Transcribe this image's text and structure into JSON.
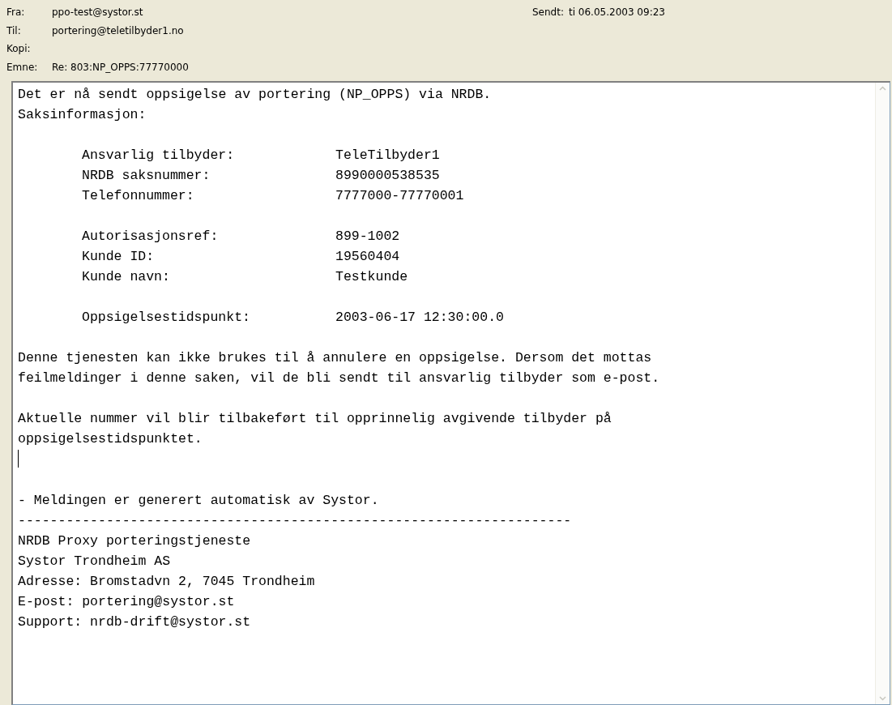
{
  "header": {
    "fields": [
      {
        "label": "Fra:",
        "value": "ppo-test@systor.st"
      },
      {
        "label": "Til:",
        "value": "portering@teletilbyder1.no"
      },
      {
        "label": "Kopi:"
      },
      {
        "label": "Emne:",
        "value": "Re: 803:NP_OPPS:77770000"
      }
    ],
    "sent": {
      "label": "Sendt:",
      "value": "ti 06.05.2003 09:23"
    }
  },
  "body": {
    "intro": [
      "Det er nå sendt oppsigelse av portering (NP_OPPS) via NRDB.",
      "Saksinformasjon:"
    ],
    "case_groups": [
      [
        {
          "label": "Ansvarlig tilbyder:",
          "value": "TeleTilbyder1"
        },
        {
          "label": "NRDB saksnummer:",
          "value": "8990000538535"
        },
        {
          "label": "Telefonnummer:",
          "value": "7777000-77770001"
        }
      ],
      [
        {
          "label": "Autorisasjonsref:",
          "value": "899-1002"
        },
        {
          "label": "Kunde ID:",
          "value": "19560404"
        },
        {
          "label": "Kunde navn:",
          "value": "Testkunde"
        }
      ],
      [
        {
          "label": "Oppsigelsestidspunkt:",
          "value": "2003-06-17 12:30:00.0"
        }
      ]
    ],
    "paragraphs": [
      [
        "Denne tjenesten kan ikke brukes til å annulere en oppsigelse. Dersom det mottas",
        "feilmeldinger i denne saken, vil de bli sendt til ansvarlig tilbyder som e-post."
      ],
      [
        "Aktuelle nummer vil blir tilbakeført til opprinnelig avgivende tilbyder på",
        "oppsigelsestidspunktet."
      ]
    ],
    "footer_note": "- Meldingen er generert automatisk av Systor.",
    "separator": "---------------------------------------------------------------------",
    "signature": [
      "NRDB Proxy porteringstjeneste",
      "Systor Trondheim AS",
      "Adresse: Bromstadvn 2, 7045 Trondheim",
      "E-post: portering@systor.st",
      "Support: nrdb-drift@systor.st"
    ]
  }
}
